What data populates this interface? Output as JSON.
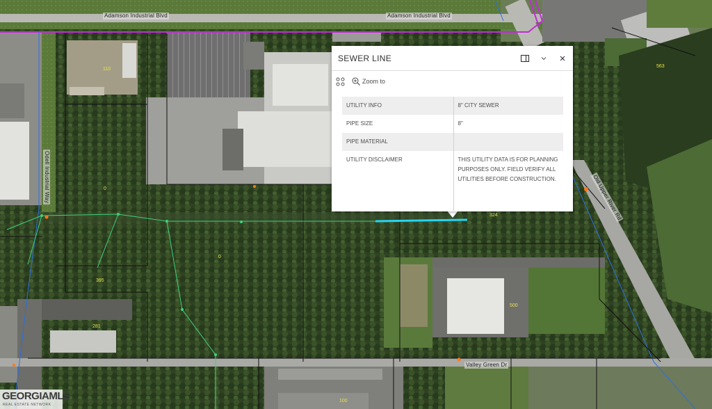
{
  "map": {
    "roads": {
      "top_road_left": "Adamson Industrial Blvd",
      "top_road_right": "Adamson Industrial Blvd",
      "left_vertical": "Odell Industrial Way",
      "right_vertical": "Old Upper River Rd",
      "bottom_road": "Valley Green Dr"
    },
    "parcel_numbers": [
      "110",
      "563",
      "324",
      "395",
      "281",
      "500",
      "0",
      "0",
      "100"
    ],
    "logo": {
      "name": "GEORGIAMLS",
      "subtitle": "REAL ESTATE NETWORK"
    },
    "colors": {
      "selected_sewer": "#23d7f2",
      "sewer_lines": "#3fd27a",
      "parcel_lines": "#101010",
      "county_line": "#c22bd6",
      "water_line": "#2b6fe0"
    }
  },
  "popup": {
    "title": "SEWER LINE",
    "buttons": {
      "dock": "dock-icon",
      "collapse": "chevron-down-icon",
      "close": "close-icon"
    },
    "actions": {
      "more": "more-options-icon",
      "zoom_label": "Zoom to"
    },
    "attributes": [
      {
        "key": "UTILITY INFO",
        "value": "8\" CITY SEWER"
      },
      {
        "key": "PIPE SIZE",
        "value": "8\""
      },
      {
        "key": "PIPE MATERIAL",
        "value": ""
      },
      {
        "key": "UTILITY DISCLAIMER",
        "value": "THIS UTILITY DATA IS FOR PLANNING PURPOSES ONLY. FIELD VERIFY ALL UTILITIES BEFORE CONSTRUCTION."
      }
    ]
  }
}
